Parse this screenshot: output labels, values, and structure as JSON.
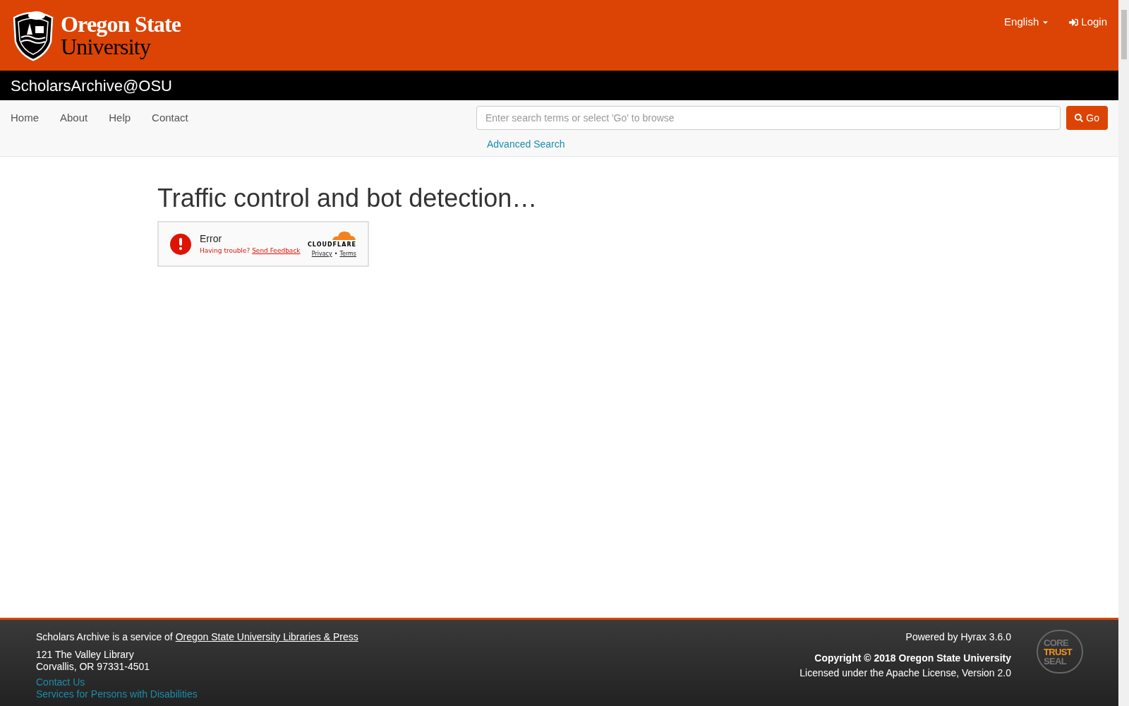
{
  "header": {
    "logo": {
      "line_1": "Oregon State",
      "line_2": "University"
    },
    "language": "English",
    "login": "Login"
  },
  "site_title": "ScholarsArchive@OSU",
  "nav": {
    "links": [
      "Home",
      "About",
      "Help",
      "Contact"
    ],
    "search": {
      "placeholder": "Enter search terms or select 'Go' to browse",
      "button": "Go"
    },
    "advanced_search": "Advanced Search"
  },
  "main": {
    "heading": "Traffic control and bot detection…",
    "widget": {
      "status": "Error",
      "trouble": "Having trouble?",
      "feedback": "Send Feedback",
      "brand": "CLOUDFLARE",
      "privacy": "Privacy",
      "separator": "•",
      "terms": "Terms"
    }
  },
  "footer": {
    "service_text": "Scholars Archive is a service of",
    "service_link": "Oregon State University Libraries & Press",
    "address": [
      "121 The Valley Library",
      "Corvallis, OR 97331-4501"
    ],
    "links": [
      "Contact Us",
      "Services for Persons with Disabilities"
    ],
    "powered": "Powered by Hyrax 3.6.0",
    "copyright": "Copyright © 2018 Oregon State University",
    "license": "Licensed under the Apache License, Version 2.0",
    "seal": [
      "CORE",
      "TRUST",
      "SEAL"
    ]
  }
}
